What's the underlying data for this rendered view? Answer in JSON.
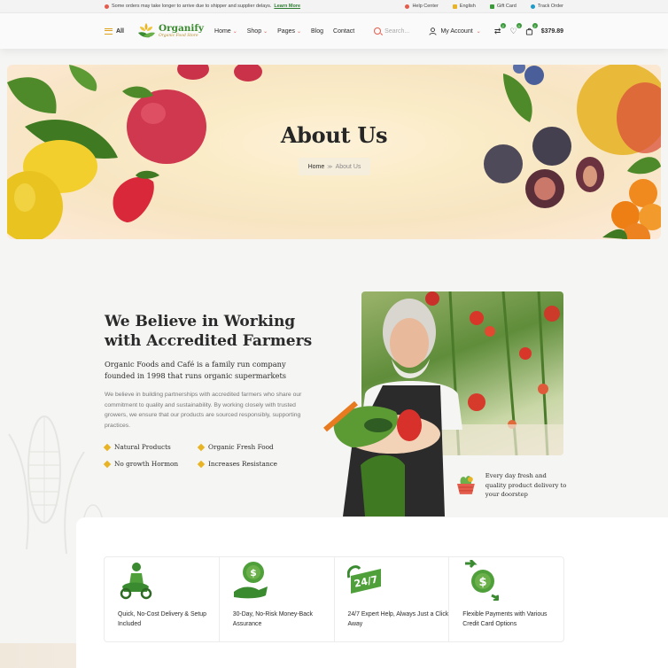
{
  "topbar": {
    "notice": "Some orders may take longer to arrive due to shipper and supplier delays.",
    "notice_link": "Learn More",
    "links": [
      {
        "label": "Help Center",
        "icon": "help-icon",
        "color": "#e45c4c"
      },
      {
        "label": "English",
        "icon": "flag-icon",
        "color": "#e8b325"
      },
      {
        "label": "Gift Card",
        "icon": "gift-icon",
        "color": "#3a9a3a"
      },
      {
        "label": "Track Order",
        "icon": "track-icon",
        "color": "#1f9bc7"
      }
    ]
  },
  "header": {
    "all_label": "All",
    "logo_name": "Organify",
    "logo_tagline": "Organic Food Store",
    "nav": [
      {
        "label": "Home",
        "dropdown": true
      },
      {
        "label": "Shop",
        "dropdown": true
      },
      {
        "label": "Pages",
        "dropdown": true
      },
      {
        "label": "Blog",
        "dropdown": false
      },
      {
        "label": "Contact",
        "dropdown": false
      }
    ],
    "search_placeholder": "Search...",
    "account_label": "My Account",
    "compare_count": "2",
    "wishlist_count": "0",
    "cart_count": "2",
    "cart_total": "$379.89"
  },
  "hero": {
    "title": "About Us",
    "breadcrumb_home": "Home",
    "breadcrumb_current": "About Us"
  },
  "about": {
    "title": "We Believe in Working with Accredited Farmers",
    "lead": "Organic Foods and Café is a family run company founded in 1998 that runs organic supermarkets",
    "body": "We believe in building partnerships with accredited farmers who share our commitment to quality and sustainability. By working closely with trusted growers, we ensure that our products are sourced responsibly, supporting practices.",
    "features": [
      "Natural Products",
      "Organic Fresh Food",
      "No growth Hormon",
      "Increases Resistance"
    ],
    "promo": "Every day fresh and quality product delivery to your doorstep"
  },
  "services": [
    {
      "label": "Quick, No-Cost Delivery & Setup Included",
      "icon": "delivery-scooter-icon"
    },
    {
      "label": "30-Day, No-Risk Money-Back Assurance",
      "icon": "money-back-icon"
    },
    {
      "label": "24/7 Expert Help, Always Just a Click Away",
      "icon": "support-24-7-icon"
    },
    {
      "label": "Flexible Payments with Various Credit Card Options",
      "icon": "payment-exchange-icon"
    }
  ],
  "colors": {
    "brand_green": "#3a8a2f",
    "accent_yellow": "#e8b325",
    "accent_red": "#e45c4c"
  }
}
